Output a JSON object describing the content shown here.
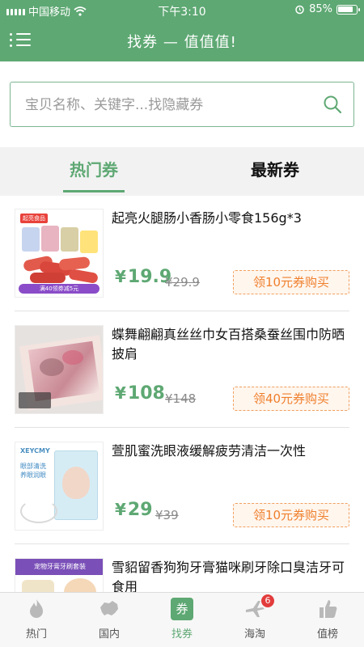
{
  "status_bar": {
    "carrier": "中国移动",
    "time": "下午3:10",
    "battery": "85%"
  },
  "header": {
    "title": "找券 — 值值值!"
  },
  "search": {
    "placeholder": "宝贝名称、关键字...找隐藏券"
  },
  "tabs": [
    {
      "label": "热门券",
      "active": true
    },
    {
      "label": "最新券",
      "active": false
    }
  ],
  "products": [
    {
      "title": "起亮火腿肠小香肠小零食156g*3",
      "price": "19.9",
      "old_price": "29.9",
      "coupon": "领10元券购买",
      "thumb_brand": "起亮食品",
      "thumb_promo": "满40领券减5元"
    },
    {
      "title": "蝶舞翩翩真丝丝巾女百搭桑蚕丝围巾防晒披肩",
      "price": "108",
      "old_price": "148",
      "coupon": "领40元券购买"
    },
    {
      "title": "萱肌蜜洗眼液缓解疲劳清洁一次性",
      "price": "29",
      "old_price": "39",
      "coupon": "领10元券购买",
      "thumb_brand": "XEYCMY",
      "thumb_text": "眼部清洗\n养眼润眼"
    },
    {
      "title": "雪貂留香狗狗牙膏猫咪刷牙除口臭洁牙可食用",
      "thumb_text": "宠物牙膏牙刷套装"
    }
  ],
  "currency_symbol": "¥",
  "bottom_nav": [
    {
      "label": "热门",
      "icon": "flame-icon",
      "active": false
    },
    {
      "label": "国内",
      "icon": "china-map-icon",
      "active": false
    },
    {
      "label": "找券",
      "icon": "coupon-icon",
      "glyph": "券",
      "active": true
    },
    {
      "label": "海淘",
      "icon": "airplane-icon",
      "badge": "6",
      "active": false
    },
    {
      "label": "值榜",
      "icon": "thumbs-up-icon",
      "active": false
    }
  ],
  "colors": {
    "brand_green": "#5ea873",
    "coupon_orange": "#ef7f2c",
    "badge_red": "#e23c3c"
  }
}
